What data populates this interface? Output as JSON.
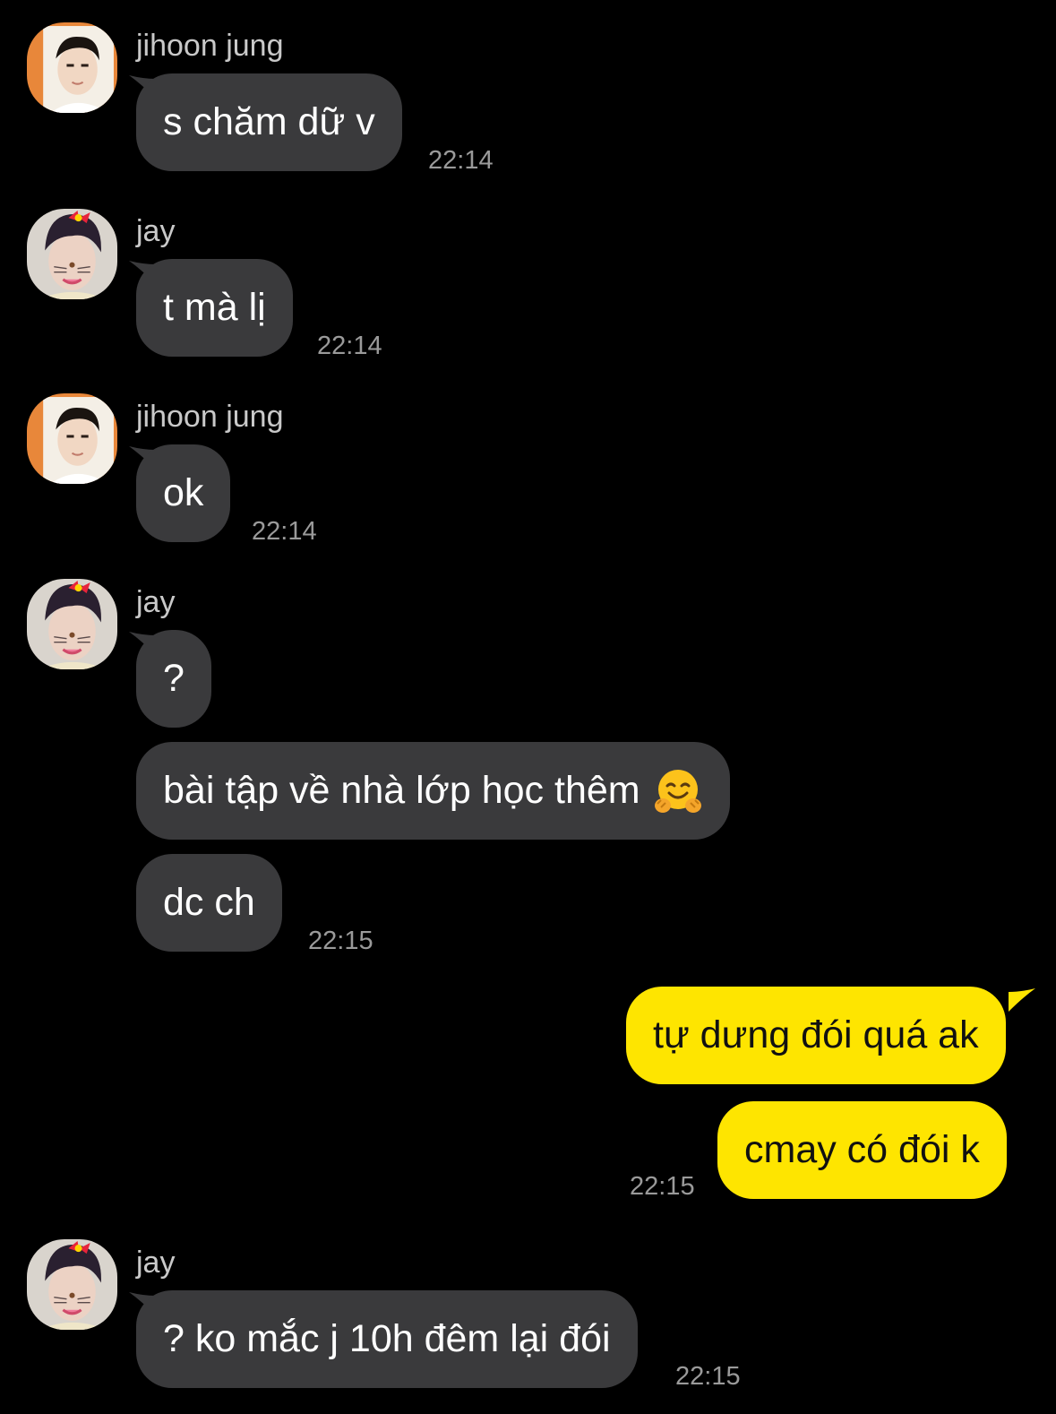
{
  "colors": {
    "background": "#000000",
    "incoming_bubble": "#3a3a3c",
    "outgoing_bubble": "#fee500",
    "timestamp": "#9a9a9a",
    "sender_name": "#c9c9c9"
  },
  "messages": [
    {
      "sender": "jihoon jung",
      "text": "s chăm dữ v",
      "time": "22:14"
    },
    {
      "sender": "jay",
      "text": "t mà lị",
      "time": "22:14"
    },
    {
      "sender": "jihoon jung",
      "text": "ok",
      "time": "22:14"
    },
    {
      "sender": "jay",
      "texts": [
        "?",
        "bài tập về nhà lớp học thêm",
        "dc ch"
      ],
      "emoji": "hugging-face-icon",
      "time": "22:15"
    },
    {
      "sender": "me",
      "texts": [
        "tự dưng đói quá ak",
        "cmay có đói k"
      ],
      "time": "22:15"
    },
    {
      "sender": "jay",
      "text": "? ko mắc j 10h đêm lại đói",
      "time": "22:15"
    }
  ]
}
